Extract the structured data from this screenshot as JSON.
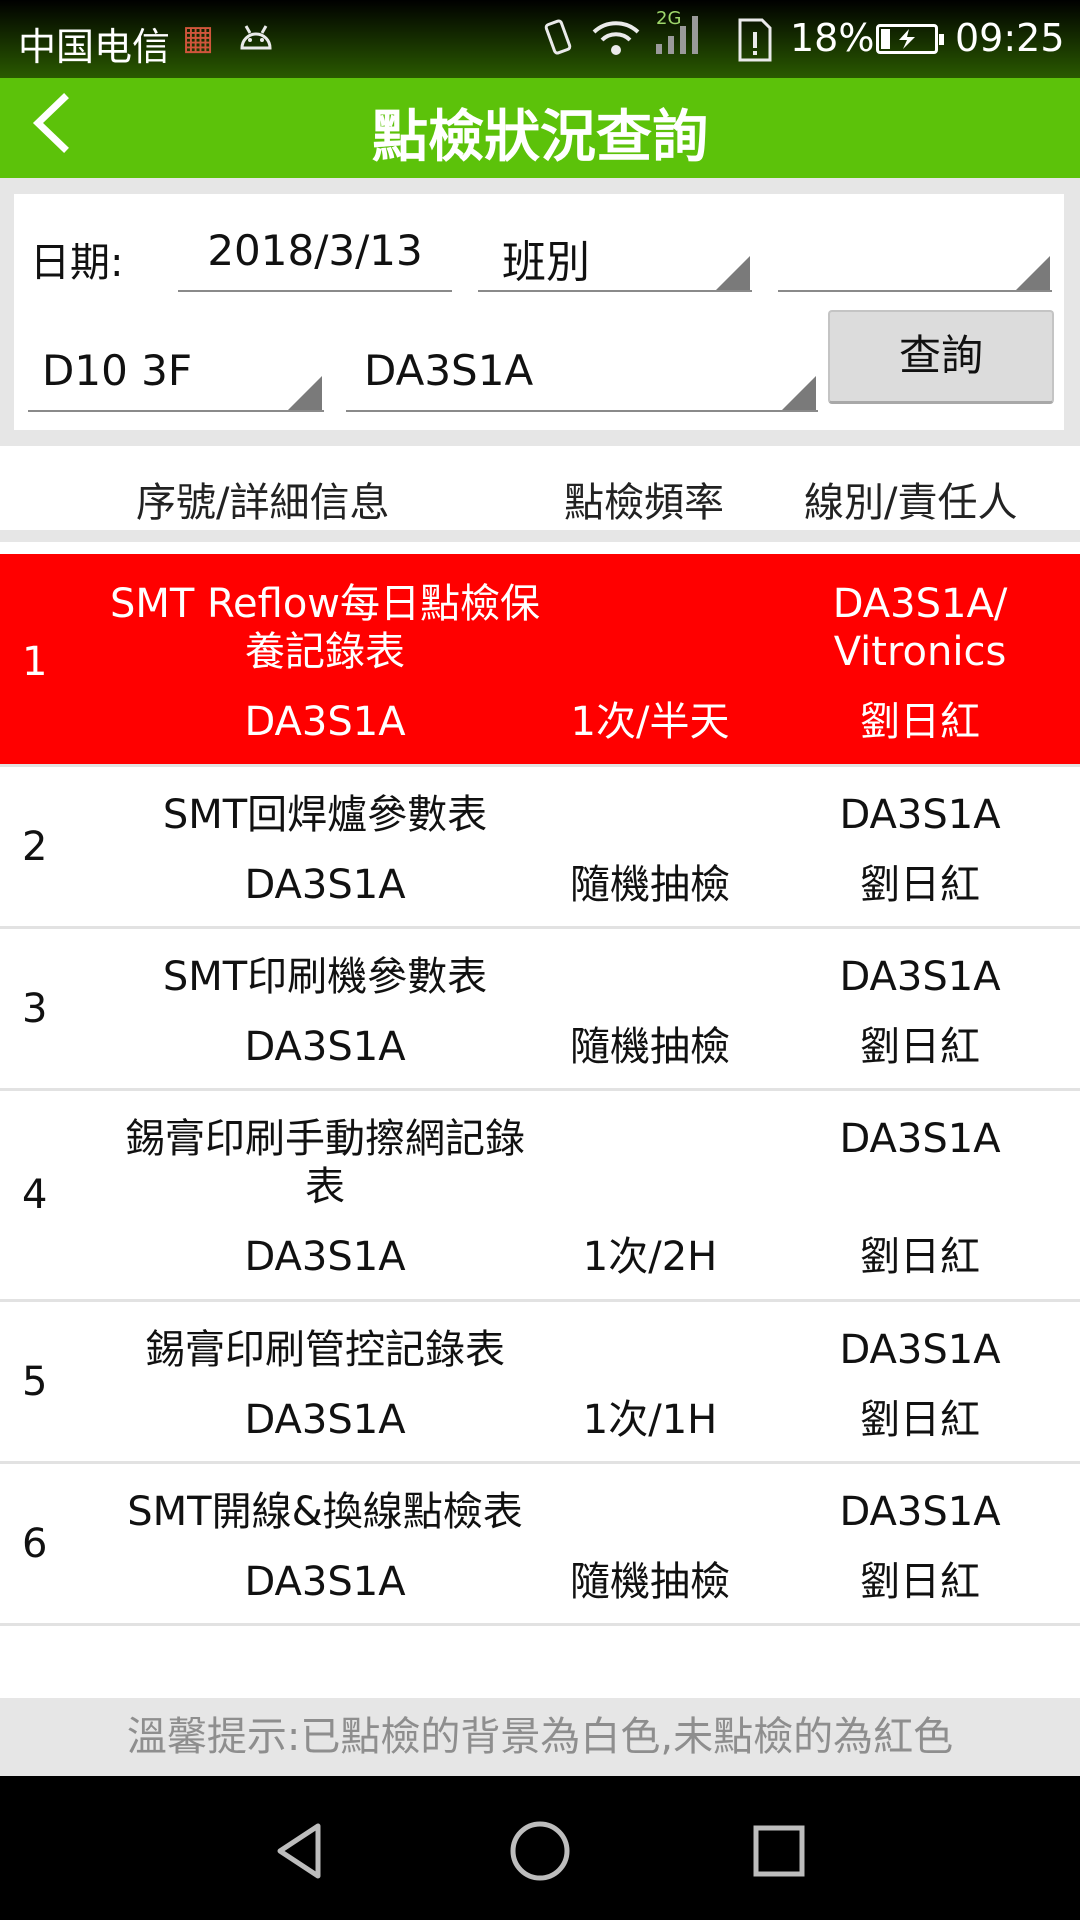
{
  "status_bar": {
    "carrier": "中国电信",
    "battery_percent": "18%",
    "battery_level": 0.18,
    "time": "09:25",
    "network": "2G",
    "icons": [
      "notification-icon",
      "android-icon",
      "vibrate-icon",
      "wifi-icon",
      "signal-icon",
      "sim-alert-icon",
      "battery-charging-icon"
    ]
  },
  "header": {
    "title": "點檢狀況查詢",
    "back_icon": "chevron-left-icon",
    "color": "#5cc20a"
  },
  "filters": {
    "date_label": "日期:",
    "date_value": "2018/3/13",
    "shift_value": "班別",
    "extra_value": "",
    "floor_value": "D10 3F",
    "line_value": "DA3S1A",
    "query_button": "查詢"
  },
  "table": {
    "headers": [
      "序號/詳細信息",
      "點檢頻率",
      "線別/責任人"
    ],
    "rows": [
      {
        "index": "1",
        "name": "SMT Reflow每日點檢保養記錄表",
        "sub": "DA3S1A",
        "frequency": "1次/半天",
        "line": "DA3S1A/ Vitronics",
        "owner": "劉日紅",
        "status": "unchecked"
      },
      {
        "index": "2",
        "name": "SMT回焊爐參數表",
        "sub": "DA3S1A",
        "frequency": "隨機抽檢",
        "line": "DA3S1A",
        "owner": "劉日紅",
        "status": "checked"
      },
      {
        "index": "3",
        "name": "SMT印刷機參數表",
        "sub": "DA3S1A",
        "frequency": "隨機抽檢",
        "line": "DA3S1A",
        "owner": "劉日紅",
        "status": "checked"
      },
      {
        "index": "4",
        "name": "錫膏印刷手動擦網記錄表",
        "sub": "DA3S1A",
        "frequency": "1次/2H",
        "line": "DA3S1A",
        "owner": "劉日紅",
        "status": "checked"
      },
      {
        "index": "5",
        "name": "錫膏印刷管控記錄表",
        "sub": "DA3S1A",
        "frequency": "1次/1H",
        "line": "DA3S1A",
        "owner": "劉日紅",
        "status": "checked"
      },
      {
        "index": "6",
        "name": "SMT開線&換線點檢表",
        "sub": "DA3S1A",
        "frequency": "隨機抽檢",
        "line": "DA3S1A",
        "owner": "劉日紅",
        "status": "checked"
      }
    ],
    "checked_color": "#ffffff",
    "unchecked_color": "#ff0000"
  },
  "tip": "溫馨提示:已點檢的背景為白色,未點檢的為紅色",
  "nav_bar": {
    "icons": [
      "back-triangle-icon",
      "home-circle-icon",
      "recents-square-icon"
    ]
  }
}
